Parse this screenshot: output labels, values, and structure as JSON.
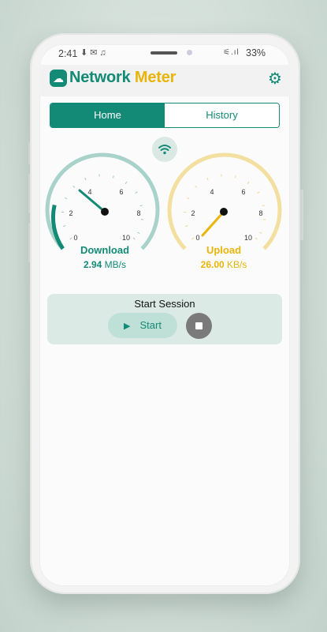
{
  "status_bar": {
    "time": "2:41",
    "battery": "33%"
  },
  "app": {
    "title_part1": "Network",
    "title_part2": "Meter"
  },
  "tabs": [
    {
      "label": "Home",
      "active": true
    },
    {
      "label": "History",
      "active": false
    }
  ],
  "gauges": {
    "download": {
      "label": "Download",
      "value": "2.94",
      "unit": "MB/s",
      "ticks": [
        "0",
        "2",
        "4",
        "6",
        "8",
        "10"
      ],
      "color": "#128a75",
      "track_color": "#a9d2ca"
    },
    "upload": {
      "label": "Upload",
      "value": "26.00",
      "unit": "KB/s",
      "ticks": [
        "0",
        "2",
        "4",
        "6",
        "8",
        "10"
      ],
      "color": "#e9b50a",
      "track_color": "#f3dfa0"
    }
  },
  "session": {
    "title": "Start Session",
    "start_label": "Start"
  },
  "colors": {
    "primary": "#128a75",
    "accent": "#e9b50a"
  },
  "icons": {
    "wifi": "wifi-icon",
    "settings": "gear-icon",
    "play": "play-icon",
    "stop": "stop-icon"
  }
}
